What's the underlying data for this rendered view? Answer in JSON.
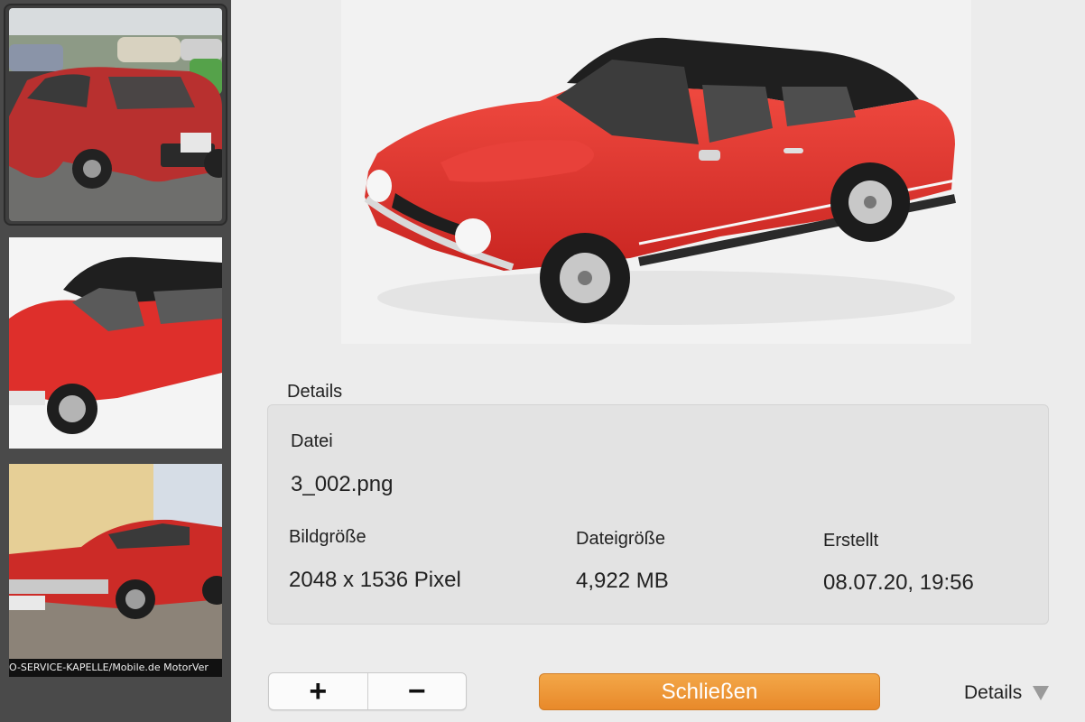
{
  "sidebar": {
    "thumbnails": [
      {
        "name": "thumbnail-1",
        "selected": true
      },
      {
        "name": "thumbnail-2",
        "selected": false
      },
      {
        "name": "thumbnail-3",
        "selected": false,
        "caption": "O-SERVICE-KAPELLE/Mobile.de MotorVer"
      }
    ]
  },
  "details": {
    "heading": "Details",
    "file_label": "Datei",
    "file_value": "3_002.png",
    "image_size_label": "Bildgröße",
    "image_size_value": "2048 x 1536 Pixel",
    "file_size_label": "Dateigröße",
    "file_size_value": "4,922 MB",
    "created_label": "Erstellt",
    "created_value": "08.07.20, 19:56"
  },
  "controls": {
    "add_label": "+",
    "remove_label": "−",
    "close_label": "Schließen",
    "details_toggle_label": "Details"
  },
  "colors": {
    "accent": "#ec9133",
    "sidebar": "#4a4a4a",
    "car_body": "#e0302b",
    "car_roof": "#1f1f1f"
  }
}
